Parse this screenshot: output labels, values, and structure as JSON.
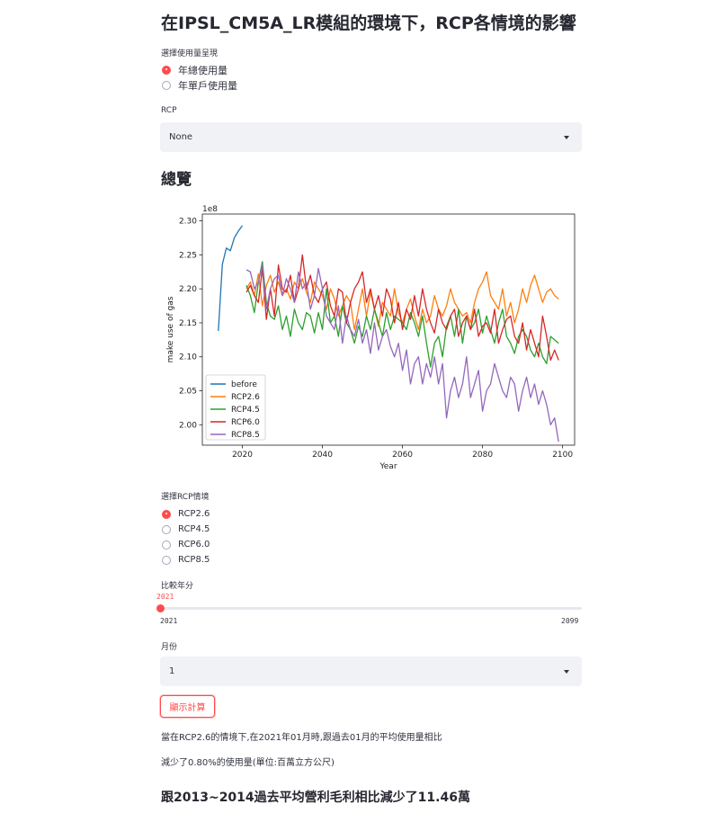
{
  "page": {
    "title": "在IPSL_CM5A_LR模組的環境下，RCP各情境的影響",
    "usage_mode": {
      "label": "選擇使用量呈現",
      "options": [
        "年總使用量",
        "年單戶使用量"
      ],
      "selected": 0
    },
    "rcp_select": {
      "label": "RCP",
      "value": "None"
    },
    "overview_heading": "總覽",
    "scenario": {
      "label": "選擇RCP情境",
      "options": [
        "RCP2.6",
        "RCP4.5",
        "RCP6.0",
        "RCP8.5"
      ],
      "selected": 0
    },
    "year_slider": {
      "label": "比較年分",
      "value": "2021",
      "min": "2021",
      "max": "2099",
      "fraction": 0
    },
    "month_select": {
      "label": "月份",
      "value": "1"
    },
    "calc_button": "顯示計算",
    "result_line1": "當在RCP2.6的情境下,在2021年01月時,跟過去01月的平均使用量相比",
    "result_line2": "減少了0.80%的使用量(單位:百萬立方公尺)",
    "result_heading": "跟2013~2014過去平均營利毛利相比減少了11.46萬"
  },
  "colors": {
    "accent": "#ff4b4b",
    "before": "#1f77b4",
    "RCP2.6": "#ff7f0e",
    "RCP4.5": "#2ca02c",
    "RCP6.0": "#d62728",
    "RCP8.5": "#9467bd"
  },
  "chart_data": {
    "type": "line",
    "xlabel": "Year",
    "ylabel": "make use of gas",
    "offset_label": "1e8",
    "xlim": [
      2010,
      2103
    ],
    "ylim": [
      1.97,
      2.31
    ],
    "xticks": [
      2020,
      2040,
      2060,
      2080,
      2100
    ],
    "yticks": [
      "2.00",
      "2.05",
      "2.10",
      "2.15",
      "2.20",
      "2.25",
      "2.30"
    ],
    "legend_position": "lower-left",
    "grid": false,
    "series": [
      {
        "name": "before",
        "x_start": 2014,
        "values": [
          2.138,
          2.236,
          2.26,
          2.256,
          2.275,
          2.285,
          2.293
        ]
      },
      {
        "name": "RCP2.6",
        "x_start": 2021,
        "values": [
          2.2,
          2.21,
          2.19,
          2.222,
          2.175,
          2.205,
          2.22,
          2.195,
          2.21,
          2.19,
          2.2,
          2.185,
          2.21,
          2.2,
          2.215,
          2.195,
          2.18,
          2.21,
          2.2,
          2.19,
          2.17,
          2.2,
          2.185,
          2.16,
          2.175,
          2.19,
          2.18,
          2.14,
          2.17,
          2.2,
          2.16,
          2.195,
          2.17,
          2.145,
          2.18,
          2.17,
          2.16,
          2.2,
          2.165,
          2.15,
          2.17,
          2.185,
          2.16,
          2.14,
          2.17,
          2.15,
          2.16,
          2.19,
          2.17,
          2.16,
          2.175,
          2.2,
          2.18,
          2.17,
          2.16,
          2.165,
          2.15,
          2.18,
          2.2,
          2.21,
          2.225,
          2.19,
          2.18,
          2.17,
          2.2,
          2.16,
          2.18,
          2.15,
          2.17,
          2.2,
          2.18,
          2.205,
          2.22,
          2.2,
          2.18,
          2.195,
          2.2,
          2.19,
          2.185
        ]
      },
      {
        "name": "RCP4.5",
        "x_start": 2021,
        "values": [
          2.205,
          2.19,
          2.165,
          2.21,
          2.24,
          2.18,
          2.16,
          2.155,
          2.175,
          2.14,
          2.16,
          2.13,
          2.17,
          2.15,
          2.14,
          2.165,
          2.16,
          2.135,
          2.165,
          2.14,
          2.2,
          2.15,
          2.16,
          2.13,
          2.175,
          2.15,
          2.14,
          2.12,
          2.145,
          2.13,
          2.16,
          2.14,
          2.17,
          2.15,
          2.13,
          2.165,
          2.14,
          2.16,
          2.155,
          2.15,
          2.14,
          2.165,
          2.15,
          2.13,
          2.16,
          2.12,
          2.085,
          2.12,
          2.13,
          2.1,
          2.145,
          2.16,
          2.13,
          2.17,
          2.12,
          2.16,
          2.14,
          2.15,
          2.17,
          2.135,
          2.16,
          2.14,
          2.12,
          2.15,
          2.17,
          2.13,
          2.12,
          2.105,
          2.13,
          2.14,
          2.13,
          2.11,
          2.1,
          2.12,
          2.1,
          2.09,
          2.13,
          2.125,
          2.12
        ]
      },
      {
        "name": "RCP6.0",
        "x_start": 2021,
        "values": [
          2.195,
          2.205,
          2.19,
          2.18,
          2.23,
          2.155,
          2.2,
          2.16,
          2.235,
          2.2,
          2.195,
          2.22,
          2.18,
          2.2,
          2.25,
          2.2,
          2.22,
          2.19,
          2.18,
          2.2,
          2.21,
          2.175,
          2.16,
          2.2,
          2.195,
          2.15,
          2.18,
          2.2,
          2.21,
          2.225,
          2.18,
          2.2,
          2.17,
          2.19,
          2.16,
          2.2,
          2.185,
          2.15,
          2.18,
          2.14,
          2.17,
          2.155,
          2.19,
          2.16,
          2.2,
          2.17,
          2.15,
          2.135,
          2.17,
          2.15,
          2.14,
          2.16,
          2.17,
          2.13,
          2.15,
          2.16,
          2.14,
          2.17,
          2.13,
          2.145,
          2.15,
          2.135,
          2.17,
          2.12,
          2.14,
          2.155,
          2.16,
          2.13,
          2.12,
          2.15,
          2.11,
          2.14,
          2.12,
          2.1,
          2.16,
          2.13,
          2.095,
          2.11,
          2.095
        ]
      },
      {
        "name": "RCP8.5",
        "x_start": 2021,
        "values": [
          2.228,
          2.225,
          2.2,
          2.21,
          2.235,
          2.17,
          2.2,
          2.215,
          2.22,
          2.19,
          2.215,
          2.2,
          2.18,
          2.225,
          2.2,
          2.21,
          2.17,
          2.19,
          2.23,
          2.2,
          2.16,
          2.15,
          2.14,
          2.175,
          2.12,
          2.16,
          2.14,
          2.13,
          2.155,
          2.12,
          2.14,
          2.105,
          2.15,
          2.11,
          2.13,
          2.14,
          2.115,
          2.1,
          2.12,
          2.08,
          2.11,
          2.06,
          2.09,
          2.1,
          2.06,
          2.09,
          2.07,
          2.1,
          2.06,
          2.09,
          2.01,
          2.05,
          2.07,
          2.04,
          2.06,
          2.1,
          2.04,
          2.06,
          2.08,
          2.02,
          2.05,
          2.06,
          2.09,
          2.07,
          2.05,
          2.04,
          2.07,
          2.06,
          2.02,
          2.05,
          2.07,
          2.04,
          2.06,
          2.03,
          2.05,
          2.03,
          2.0,
          2.01,
          1.975
        ]
      }
    ]
  }
}
